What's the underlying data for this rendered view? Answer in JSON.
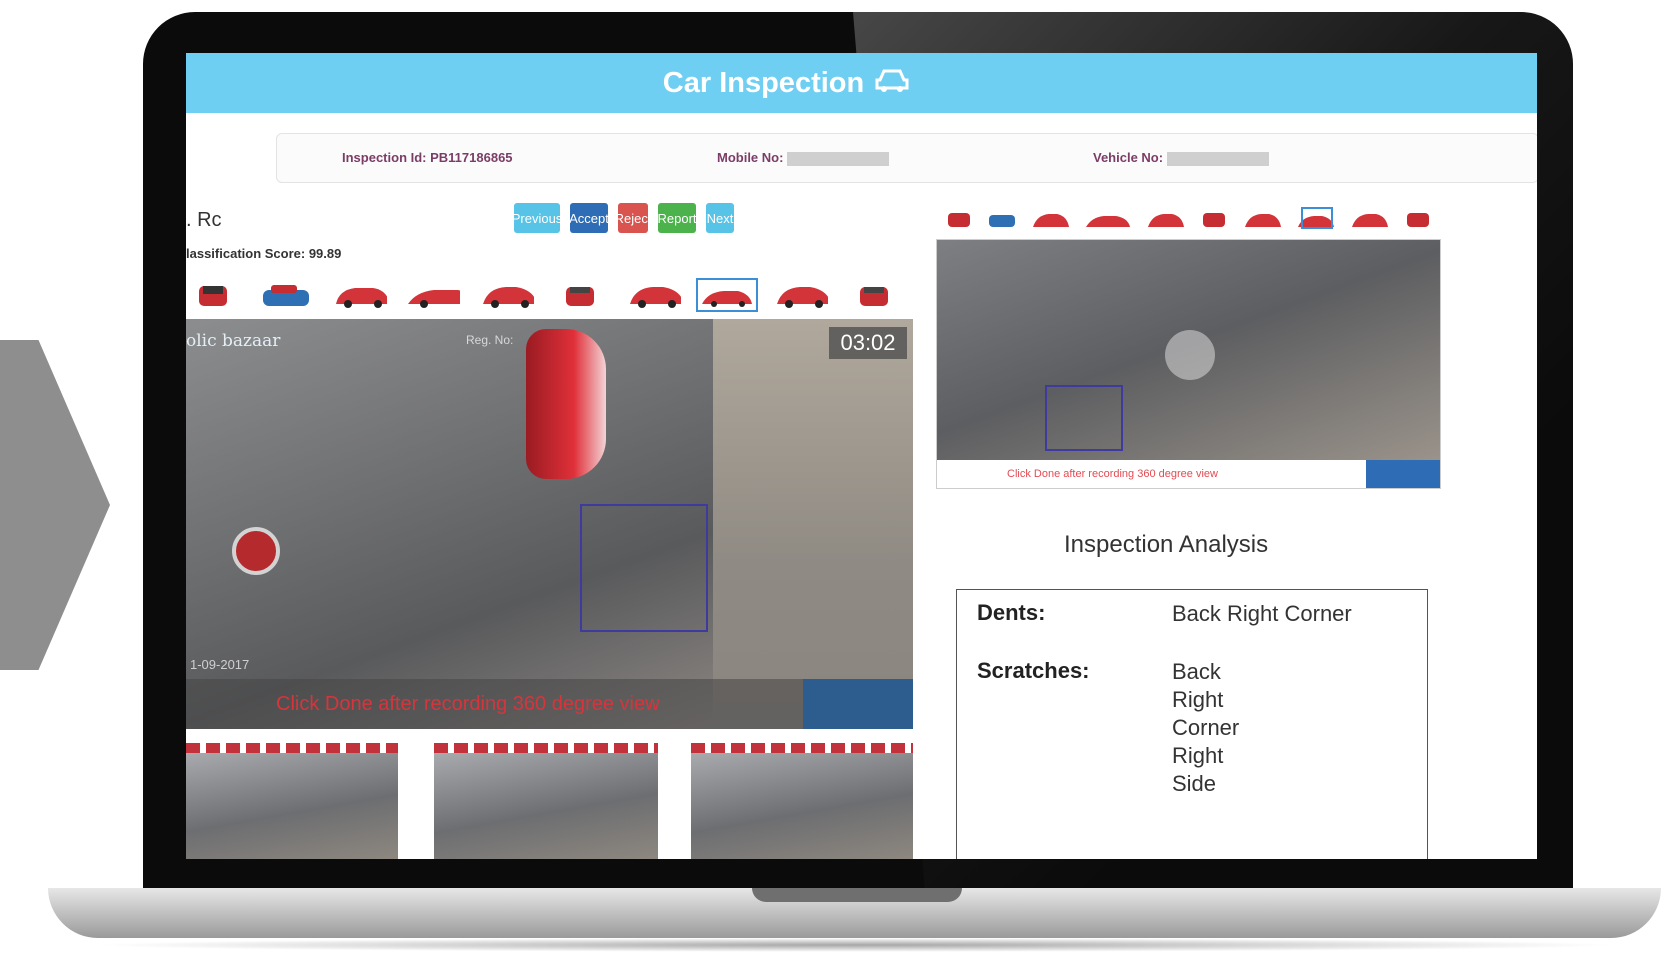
{
  "header": {
    "title": "Car Inspection",
    "icon": "car-icon"
  },
  "info": {
    "inspection_id": "Inspection Id: PB117186865",
    "mobile_label": "Mobile No:",
    "vehicle_label": "Vehicle No:"
  },
  "left": {
    "title": ". Rc",
    "score": "lassification Score: 99.89",
    "buttons": {
      "previous": "Previous",
      "accept": "Accept",
      "reject": "Reject",
      "report": "Report",
      "next": "Next"
    },
    "video": {
      "logo": "olic bazaar",
      "reg": "Reg. No:",
      "timer": "03:02",
      "date": "1-09-2017",
      "done_text": "Click Done after recording 360 degree view"
    }
  },
  "right": {
    "done_text": "Click Done after recording 360 degree view",
    "analysis_title": "Inspection Analysis",
    "analysis": [
      {
        "label": "Dents:",
        "value": "Back Right Corner"
      },
      {
        "label": "Scratches:",
        "value": "Back Right Corner\nRight Side"
      }
    ]
  },
  "colors": {
    "header": "#6fcff2",
    "accept": "#2e6db6",
    "reject": "#d9534f",
    "report": "#4cb34c",
    "info_text": "#7b3d66"
  }
}
